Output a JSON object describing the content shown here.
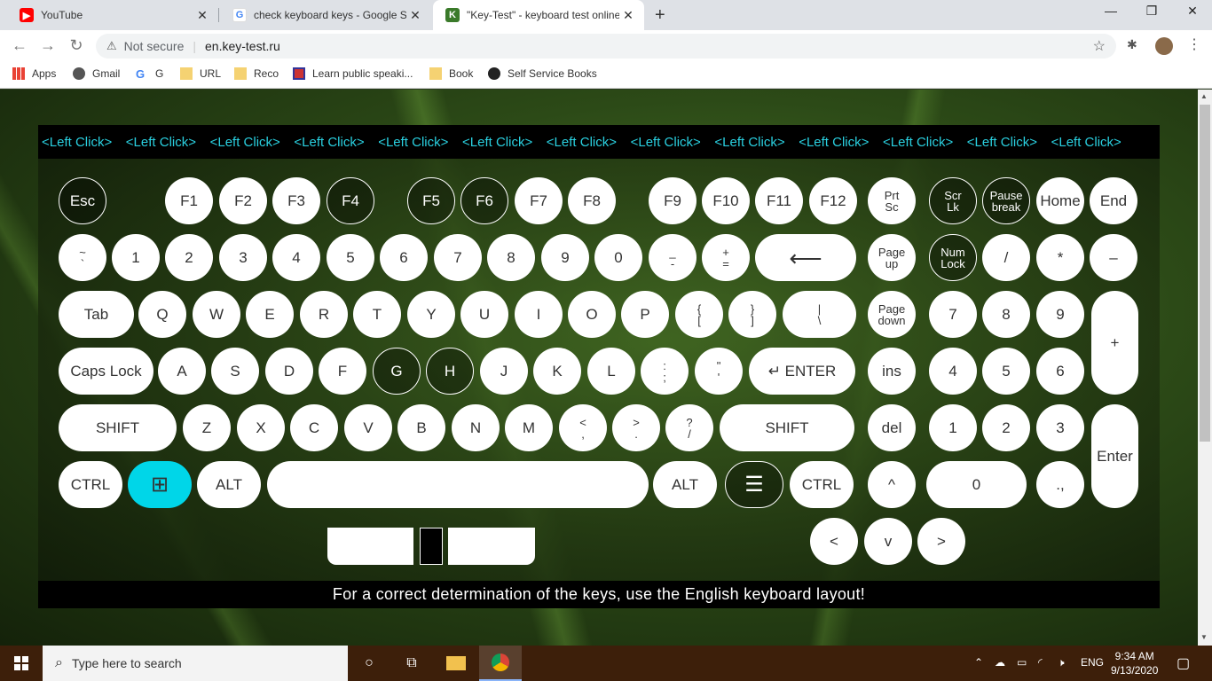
{
  "browser": {
    "tabs": [
      {
        "title": "YouTube",
        "close": "✕"
      },
      {
        "title": "check keyboard keys - Google Se",
        "close": "✕"
      },
      {
        "title": "\"Key-Test\" - keyboard test online",
        "close": "✕"
      }
    ],
    "new_tab": "+",
    "window_controls": [
      "—",
      "❐",
      "✕"
    ],
    "security": "Not secure",
    "url": "en.key-test.ru",
    "bookmarks": [
      "Apps",
      "Gmail",
      "G",
      "URL",
      "Reco",
      "Learn public speaki...",
      "Book",
      "Self Service Books"
    ]
  },
  "keyboard": {
    "left_click_label": "<Left Click>",
    "left_click_count": 13,
    "row_fn": [
      "Esc",
      "F1",
      "F2",
      "F3",
      "F4",
      "F5",
      "F6",
      "F7",
      "F8",
      "F9",
      "F10",
      "F11",
      "F12"
    ],
    "nav_top": [
      [
        "Prt",
        "Sc"
      ],
      [
        "Scr",
        "Lk"
      ],
      [
        "Pause",
        "break"
      ],
      [
        "Home"
      ],
      [
        "End"
      ]
    ],
    "row_num": [
      [
        "~",
        "`"
      ],
      [
        "1"
      ],
      [
        "2"
      ],
      [
        "3"
      ],
      [
        "4"
      ],
      [
        "5"
      ],
      [
        "6"
      ],
      [
        "7"
      ],
      [
        "8"
      ],
      [
        "9"
      ],
      [
        "0"
      ],
      [
        "_",
        "-"
      ],
      [
        "+",
        "="
      ],
      [
        "⟵"
      ]
    ],
    "row_num_extra": [
      [
        "Page",
        "up"
      ],
      [
        "Num",
        "Lock"
      ],
      [
        "/"
      ],
      [
        "*"
      ],
      [
        "–"
      ]
    ],
    "row_q": [
      [
        "Tab"
      ],
      [
        "Q"
      ],
      [
        "W"
      ],
      [
        "E"
      ],
      [
        "R"
      ],
      [
        "T"
      ],
      [
        "Y"
      ],
      [
        "U"
      ],
      [
        "I"
      ],
      [
        "O"
      ],
      [
        "P"
      ],
      [
        "{",
        "["
      ],
      [
        "}",
        "]"
      ],
      [
        "|",
        "\\"
      ]
    ],
    "row_q_extra": [
      [
        "Page",
        "down"
      ],
      [
        "7"
      ],
      [
        "8"
      ],
      [
        "9"
      ],
      [
        "+"
      ]
    ],
    "row_a": [
      [
        "Caps Lock"
      ],
      [
        "A"
      ],
      [
        "S"
      ],
      [
        "D"
      ],
      [
        "F"
      ],
      [
        "G"
      ],
      [
        "H"
      ],
      [
        "J"
      ],
      [
        "K"
      ],
      [
        "L"
      ],
      [
        ":",
        ";"
      ],
      [
        "\"",
        "'"
      ],
      [
        "↵ ENTER"
      ]
    ],
    "row_a_extra": [
      [
        "ins"
      ],
      [
        "4"
      ],
      [
        "5"
      ],
      [
        "6"
      ]
    ],
    "row_z": [
      [
        "SHIFT"
      ],
      [
        "Z"
      ],
      [
        "X"
      ],
      [
        "C"
      ],
      [
        "V"
      ],
      [
        "B"
      ],
      [
        "N"
      ],
      [
        "M"
      ],
      [
        "<",
        ","
      ],
      [
        ">",
        "."
      ],
      [
        "?",
        "/"
      ],
      [
        "SHIFT"
      ]
    ],
    "row_z_extra": [
      [
        "del"
      ],
      [
        "1"
      ],
      [
        "2"
      ],
      [
        "3"
      ],
      [
        "Enter"
      ]
    ],
    "row_ctrl": [
      [
        "CTRL"
      ],
      [
        "⊞"
      ],
      [
        "ALT"
      ],
      [
        ""
      ],
      [
        "ALT"
      ],
      [
        "☰"
      ],
      [
        "CTRL"
      ]
    ],
    "row_ctrl_extra": [
      [
        "^"
      ],
      [
        "0"
      ],
      [
        ".,"
      ]
    ],
    "arrows": [
      "<",
      "v",
      ">"
    ],
    "footer": "For a correct determination of the keys, use the English keyboard layout!",
    "highlight_color": "#00d6e8"
  },
  "taskbar": {
    "search_placeholder": "Type here to search",
    "lang": "ENG",
    "time": "9:34 AM",
    "date": "9/13/2020"
  }
}
